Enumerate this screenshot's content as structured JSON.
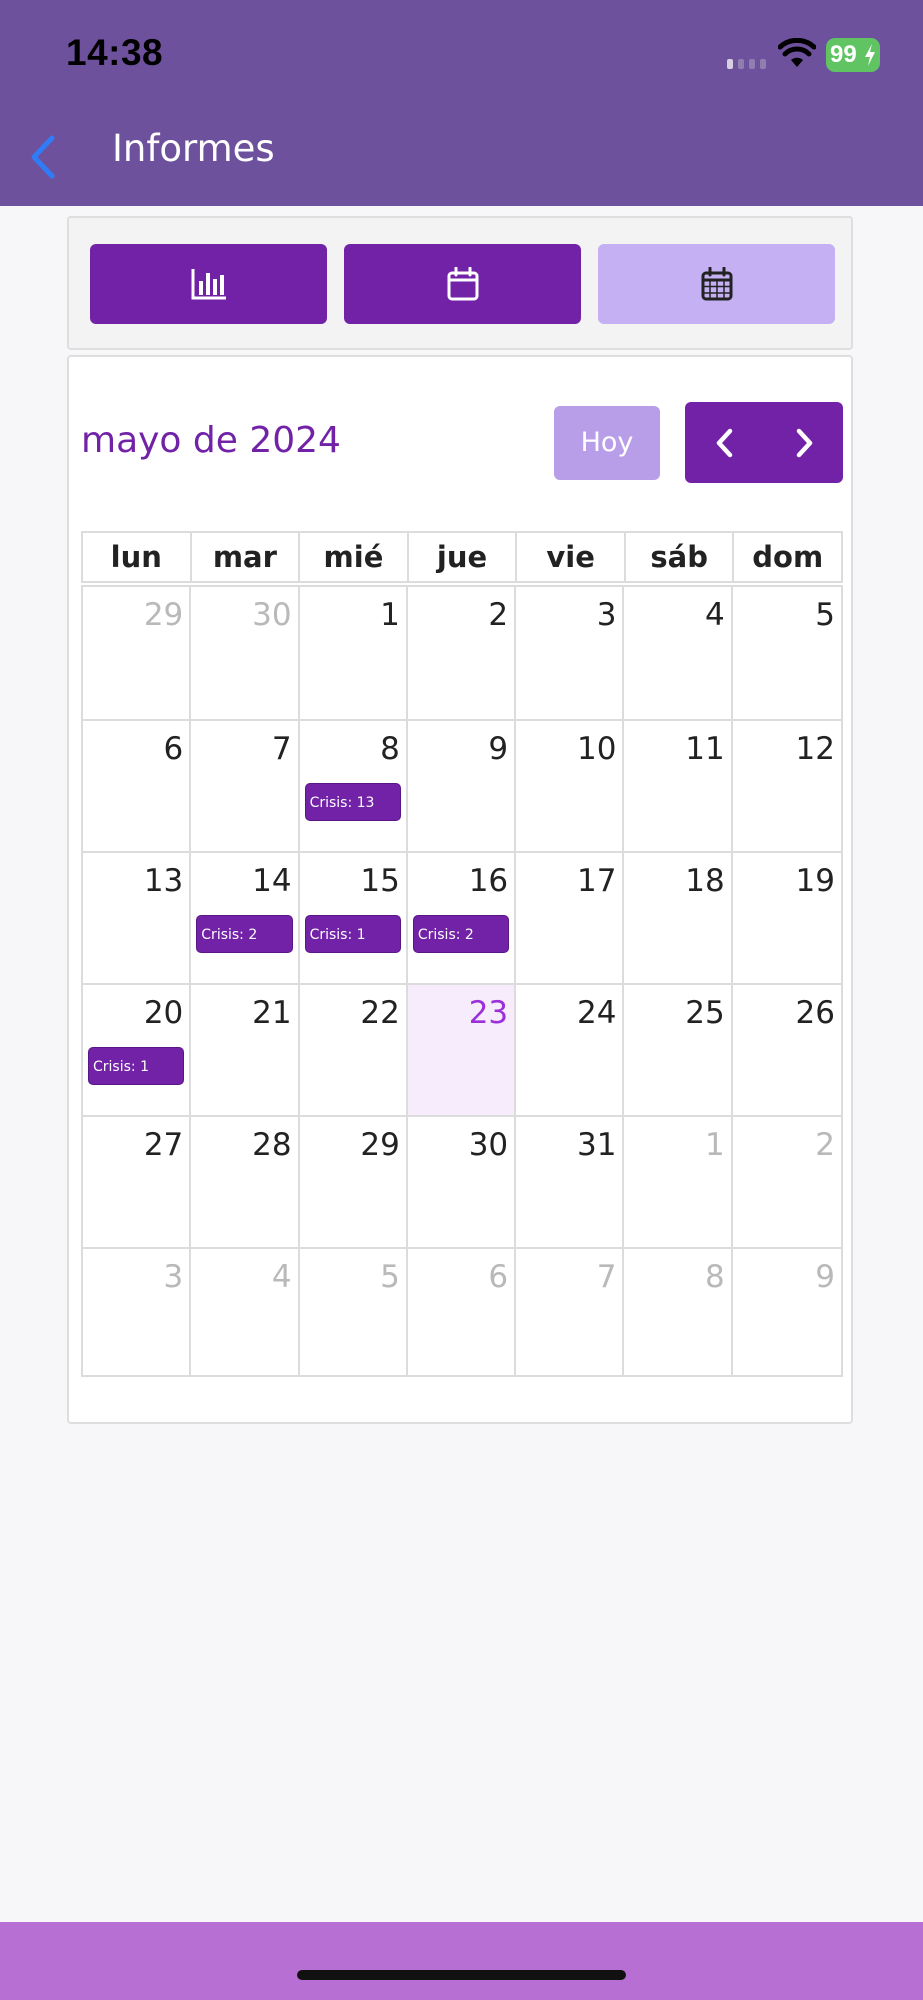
{
  "status_bar": {
    "time": "14:38",
    "battery": "99"
  },
  "nav": {
    "title": "Informes"
  },
  "mode_tabs": [
    {
      "name": "chart-view",
      "icon": "bar-chart-icon",
      "active": false
    },
    {
      "name": "day-view",
      "icon": "calendar-icon",
      "active": false
    },
    {
      "name": "month-view",
      "icon": "calendar-grid-icon",
      "active": true
    }
  ],
  "calendar": {
    "month_title": "mayo de 2024",
    "today_label": "Hoy",
    "weekdays": [
      "lun",
      "mar",
      "mié",
      "jue",
      "vie",
      "sáb",
      "dom"
    ],
    "weeks": [
      [
        {
          "day": "29",
          "other": true
        },
        {
          "day": "30",
          "other": true
        },
        {
          "day": "1"
        },
        {
          "day": "2"
        },
        {
          "day": "3"
        },
        {
          "day": "4"
        },
        {
          "day": "5"
        }
      ],
      [
        {
          "day": "6"
        },
        {
          "day": "7"
        },
        {
          "day": "8",
          "event": "Crisis: 13"
        },
        {
          "day": "9"
        },
        {
          "day": "10"
        },
        {
          "day": "11"
        },
        {
          "day": "12"
        }
      ],
      [
        {
          "day": "13"
        },
        {
          "day": "14",
          "event": "Crisis: 2"
        },
        {
          "day": "15",
          "event": "Crisis: 1"
        },
        {
          "day": "16",
          "event": "Crisis: 2"
        },
        {
          "day": "17"
        },
        {
          "day": "18"
        },
        {
          "day": "19"
        }
      ],
      [
        {
          "day": "20",
          "event": "Crisis: 1"
        },
        {
          "day": "21"
        },
        {
          "day": "22"
        },
        {
          "day": "23",
          "today": true
        },
        {
          "day": "24"
        },
        {
          "day": "25"
        },
        {
          "day": "26"
        }
      ],
      [
        {
          "day": "27"
        },
        {
          "day": "28"
        },
        {
          "day": "29"
        },
        {
          "day": "30"
        },
        {
          "day": "31"
        },
        {
          "day": "1",
          "other": true
        },
        {
          "day": "2",
          "other": true
        }
      ],
      [
        {
          "day": "3",
          "other": true
        },
        {
          "day": "4",
          "other": true
        },
        {
          "day": "5",
          "other": true
        },
        {
          "day": "6",
          "other": true
        },
        {
          "day": "7",
          "other": true
        },
        {
          "day": "8",
          "other": true
        },
        {
          "day": "9",
          "other": true
        }
      ]
    ]
  },
  "colors": {
    "header": "#6d519d",
    "primary": "#7222a7",
    "active_tab": "#c4b0f2",
    "today_highlight": "#f6ecfc",
    "today_number": "#9b30d9",
    "bottom_bar": "#b86fd3"
  }
}
